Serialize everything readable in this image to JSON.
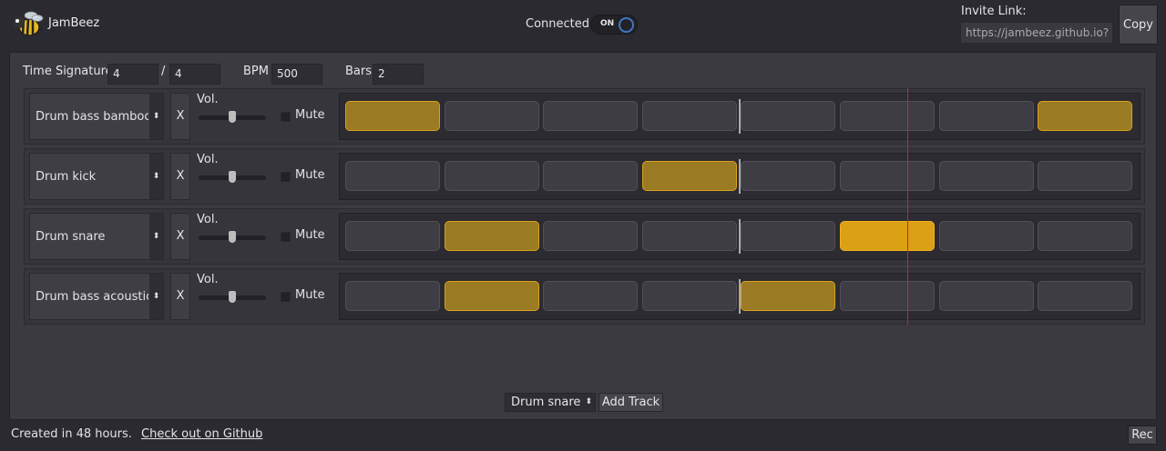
{
  "app": {
    "title": "JamBeez"
  },
  "connection": {
    "label": "Connected",
    "toggle_text": "ON",
    "state": "on"
  },
  "invite": {
    "label": "Invite Link:",
    "value": "https://jambeez.github.io?",
    "copy_label": "Copy"
  },
  "config": {
    "time_signature_label": "Time Signature",
    "time_sig_numerator": "4",
    "separator": "/",
    "time_sig_denominator": "4",
    "bpm_label": "BPM",
    "bpm_value": "500",
    "bars_label": "Bars",
    "bars_value": "2"
  },
  "common": {
    "vol_label": "Vol.",
    "mute_label": "Mute",
    "delete_label": "X",
    "select_arrow": "⬍"
  },
  "tracks": [
    {
      "name": "Drum bass bamboo",
      "volume": 0.5,
      "muted": false,
      "steps": [
        1,
        0,
        0,
        0,
        0,
        0,
        0,
        1
      ]
    },
    {
      "name": "Drum kick",
      "volume": 0.5,
      "muted": false,
      "steps": [
        0,
        0,
        0,
        1,
        0,
        0,
        0,
        0
      ]
    },
    {
      "name": "Drum snare",
      "volume": 0.5,
      "muted": false,
      "steps": [
        0,
        1,
        0,
        0,
        0,
        2,
        0,
        0
      ]
    },
    {
      "name": "Drum bass acoustic",
      "volume": 0.5,
      "muted": false,
      "steps": [
        0,
        1,
        0,
        0,
        1,
        0,
        0,
        0
      ]
    }
  ],
  "add_track": {
    "selected": "Drum snare",
    "button_label": "Add Track"
  },
  "footer": {
    "text": "Created in 48 hours.",
    "link": "Check out on Github",
    "rec_label": "Rec"
  },
  "colors": {
    "step_on": "#9b7a24",
    "step_current": "#dba013",
    "playhead": "#c8282a",
    "toggle_accent": "#3e78c2"
  }
}
